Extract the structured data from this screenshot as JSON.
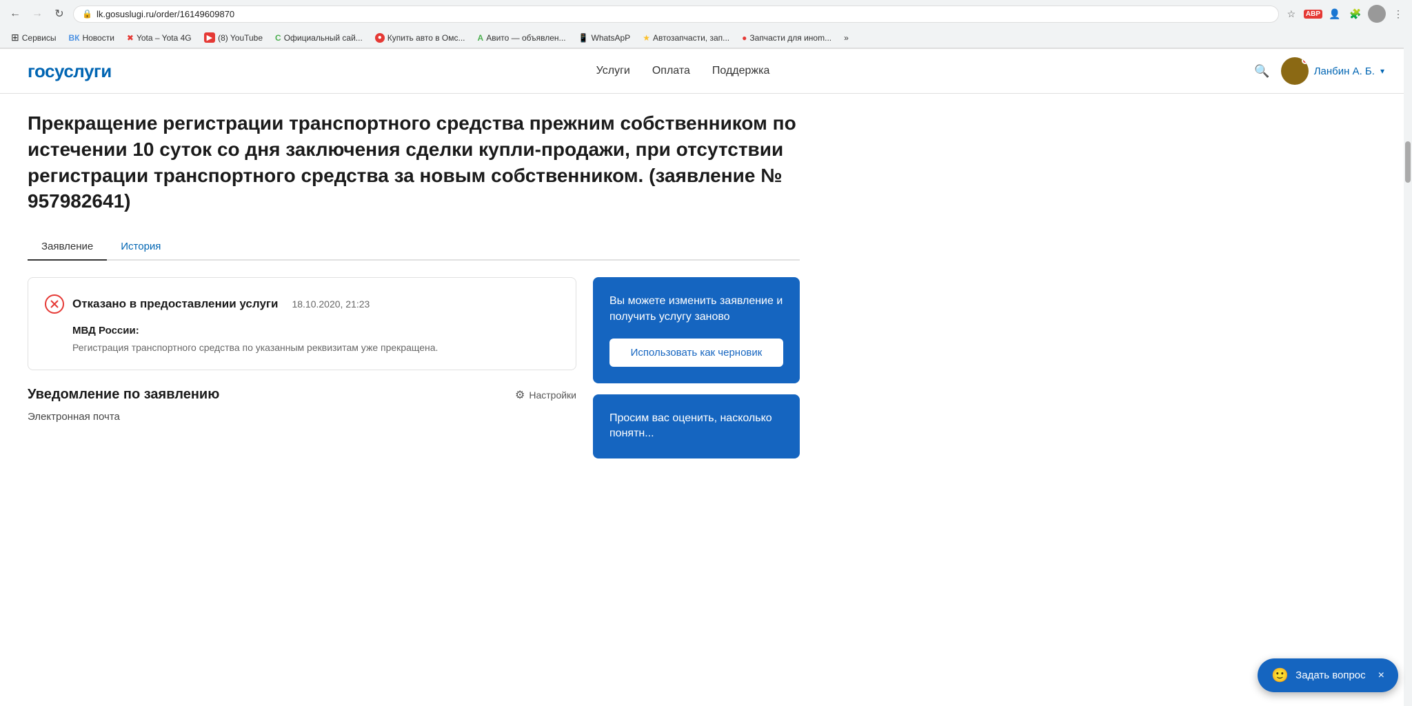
{
  "browser": {
    "url": "lk.gosuslugi.ru/order/16149609870",
    "back_disabled": false,
    "forward_disabled": true,
    "bookmarks": [
      {
        "label": "Сервисы",
        "icon": "⊞"
      },
      {
        "label": "Новости",
        "icon": "🔵",
        "color": "#4a90e2"
      },
      {
        "label": "Yota – Yota 4G",
        "icon": "✖",
        "color": "#e53935"
      },
      {
        "label": "(8) YouTube",
        "icon": "▶",
        "color": "#e53935"
      },
      {
        "label": "Официальный сай...",
        "icon": "C",
        "color": "#4caf50"
      },
      {
        "label": "Купить авто в Омс...",
        "icon": "🔴"
      },
      {
        "label": "Авито — объявлен...",
        "icon": "🟢"
      },
      {
        "label": "WhatsApP",
        "icon": "📱",
        "color": "#4caf50"
      },
      {
        "label": "Автозапчасти, зап...",
        "icon": "🟡"
      },
      {
        "label": "Запчасти для иноm...",
        "icon": "🔴"
      },
      {
        "label": "»",
        "icon": "»"
      }
    ]
  },
  "header": {
    "logo": "госуслуги",
    "nav": [
      "Услуги",
      "Оплата",
      "Поддержка"
    ],
    "user_name": "Ланбин А. Б.",
    "search_placeholder": "Поиск"
  },
  "page": {
    "title": "Прекращение регистрации транспортного средства прежним собственником по истечении 10 суток со дня заключения сделки купли-продажи, при отсутствии регистрации транспортного средства за новым собственником. (заявление № 957982641)",
    "tabs": [
      {
        "label": "Заявление",
        "active": true
      },
      {
        "label": "История",
        "active": false
      }
    ]
  },
  "status": {
    "title": "Отказано в предоставлении услуги",
    "date": "18.10.2020, 21:23",
    "org": "МВД России:",
    "description": "Регистрация транспортного средства по указанным реквизитам уже прекращена."
  },
  "notification_section": {
    "title": "Уведомление по заявлению",
    "settings_label": "Настройки",
    "email_label": "Электронная почта"
  },
  "sidebar": {
    "card1": {
      "text": "Вы можете изменить заявление и получить услугу заново",
      "button_label": "Использовать как черновик"
    },
    "card2": {
      "text": "Просим вас оценить, насколько понятн..."
    }
  },
  "chat_widget": {
    "label": "Задать вопрос",
    "close": "×"
  }
}
